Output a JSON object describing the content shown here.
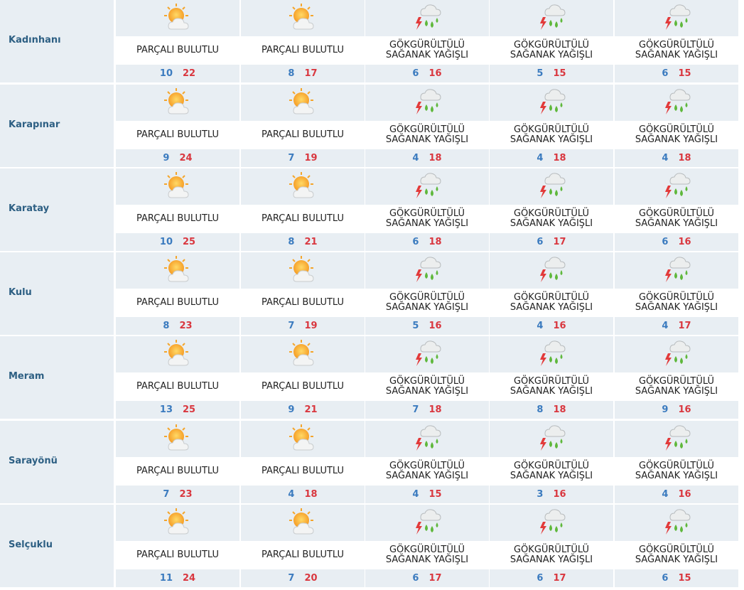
{
  "colors": {
    "panel": "#e8eef3",
    "district": "#2d5f83",
    "min_temp": "#3b7bbf",
    "max_temp": "#d9373f"
  },
  "rows": [
    {
      "district": "Kadınhanı",
      "days": [
        {
          "icon": "partly-cloudy-icon",
          "condition": "PARÇALI BULUTLU",
          "min": "10",
          "max": "22"
        },
        {
          "icon": "partly-cloudy-icon",
          "condition": "PARÇALI BULUTLU",
          "min": "8",
          "max": "17"
        },
        {
          "icon": "thunderstorm-rain-icon",
          "condition": "GÖKGÜRÜLTÜLÜ\nSAĞANAK YAĞIŞLI",
          "min": "6",
          "max": "16"
        },
        {
          "icon": "thunderstorm-rain-icon",
          "condition": "GÖKGÜRÜLTÜLÜ\nSAĞANAK YAĞIŞLI",
          "min": "5",
          "max": "15"
        },
        {
          "icon": "thunderstorm-rain-icon",
          "condition": "GÖKGÜRÜLTÜLÜ\nSAĞANAK YAĞIŞLI",
          "min": "6",
          "max": "15"
        }
      ]
    },
    {
      "district": "Karapınar",
      "days": [
        {
          "icon": "partly-cloudy-icon",
          "condition": "PARÇALI BULUTLU",
          "min": "9",
          "max": "24"
        },
        {
          "icon": "partly-cloudy-icon",
          "condition": "PARÇALI BULUTLU",
          "min": "7",
          "max": "19"
        },
        {
          "icon": "thunderstorm-rain-icon",
          "condition": "GÖKGÜRÜLTÜLÜ\nSAĞANAK YAĞIŞLI",
          "min": "4",
          "max": "18"
        },
        {
          "icon": "thunderstorm-rain-icon",
          "condition": "GÖKGÜRÜLTÜLÜ\nSAĞANAK YAĞIŞLI",
          "min": "4",
          "max": "18"
        },
        {
          "icon": "thunderstorm-rain-icon",
          "condition": "GÖKGÜRÜLTÜLÜ\nSAĞANAK YAĞIŞLI",
          "min": "4",
          "max": "18"
        }
      ]
    },
    {
      "district": "Karatay",
      "days": [
        {
          "icon": "partly-cloudy-icon",
          "condition": "PARÇALI BULUTLU",
          "min": "10",
          "max": "25"
        },
        {
          "icon": "partly-cloudy-icon",
          "condition": "PARÇALI BULUTLU",
          "min": "8",
          "max": "21"
        },
        {
          "icon": "thunderstorm-rain-icon",
          "condition": "GÖKGÜRÜLTÜLÜ\nSAĞANAK YAĞIŞLI",
          "min": "6",
          "max": "18"
        },
        {
          "icon": "thunderstorm-rain-icon",
          "condition": "GÖKGÜRÜLTÜLÜ\nSAĞANAK YAĞIŞLI",
          "min": "6",
          "max": "17"
        },
        {
          "icon": "thunderstorm-rain-icon",
          "condition": "GÖKGÜRÜLTÜLÜ\nSAĞANAK YAĞIŞLI",
          "min": "6",
          "max": "16"
        }
      ]
    },
    {
      "district": "Kulu",
      "days": [
        {
          "icon": "partly-cloudy-icon",
          "condition": "PARÇALI BULUTLU",
          "min": "8",
          "max": "23"
        },
        {
          "icon": "partly-cloudy-icon",
          "condition": "PARÇALI BULUTLU",
          "min": "7",
          "max": "19"
        },
        {
          "icon": "thunderstorm-rain-icon",
          "condition": "GÖKGÜRÜLTÜLÜ\nSAĞANAK YAĞIŞLI",
          "min": "5",
          "max": "16"
        },
        {
          "icon": "thunderstorm-rain-icon",
          "condition": "GÖKGÜRÜLTÜLÜ\nSAĞANAK YAĞIŞLI",
          "min": "4",
          "max": "16"
        },
        {
          "icon": "thunderstorm-rain-icon",
          "condition": "GÖKGÜRÜLTÜLÜ\nSAĞANAK YAĞIŞLI",
          "min": "4",
          "max": "17"
        }
      ]
    },
    {
      "district": "Meram",
      "days": [
        {
          "icon": "partly-cloudy-icon",
          "condition": "PARÇALI BULUTLU",
          "min": "13",
          "max": "25"
        },
        {
          "icon": "partly-cloudy-icon",
          "condition": "PARÇALI BULUTLU",
          "min": "9",
          "max": "21"
        },
        {
          "icon": "thunderstorm-rain-icon",
          "condition": "GÖKGÜRÜLTÜLÜ\nSAĞANAK YAĞIŞLI",
          "min": "7",
          "max": "18"
        },
        {
          "icon": "thunderstorm-rain-icon",
          "condition": "GÖKGÜRÜLTÜLÜ\nSAĞANAK YAĞIŞLI",
          "min": "8",
          "max": "18"
        },
        {
          "icon": "thunderstorm-rain-icon",
          "condition": "GÖKGÜRÜLTÜLÜ\nSAĞANAK YAĞIŞLI",
          "min": "9",
          "max": "16"
        }
      ]
    },
    {
      "district": "Sarayönü",
      "days": [
        {
          "icon": "partly-cloudy-icon",
          "condition": "PARÇALI BULUTLU",
          "min": "7",
          "max": "23"
        },
        {
          "icon": "partly-cloudy-icon",
          "condition": "PARÇALI BULUTLU",
          "min": "4",
          "max": "18"
        },
        {
          "icon": "thunderstorm-rain-icon",
          "condition": "GÖKGÜRÜLTÜLÜ\nSAĞANAK YAĞIŞLI",
          "min": "4",
          "max": "15"
        },
        {
          "icon": "thunderstorm-rain-icon",
          "condition": "GÖKGÜRÜLTÜLÜ\nSAĞANAK YAĞIŞLI",
          "min": "3",
          "max": "16"
        },
        {
          "icon": "thunderstorm-rain-icon",
          "condition": "GÖKGÜRÜLTÜLÜ\nSAĞANAK YAĞIŞLI",
          "min": "4",
          "max": "16"
        }
      ]
    },
    {
      "district": "Selçuklu",
      "days": [
        {
          "icon": "partly-cloudy-icon",
          "condition": "PARÇALI BULUTLU",
          "min": "11",
          "max": "24"
        },
        {
          "icon": "partly-cloudy-icon",
          "condition": "PARÇALI BULUTLU",
          "min": "7",
          "max": "20"
        },
        {
          "icon": "thunderstorm-rain-icon",
          "condition": "GÖKGÜRÜLTÜLÜ\nSAĞANAK YAĞIŞLI",
          "min": "6",
          "max": "17"
        },
        {
          "icon": "thunderstorm-rain-icon",
          "condition": "GÖKGÜRÜLTÜLÜ\nSAĞANAK YAĞIŞLI",
          "min": "6",
          "max": "17"
        },
        {
          "icon": "thunderstorm-rain-icon",
          "condition": "GÖKGÜRÜLTÜLÜ\nSAĞANAK YAĞIŞLI",
          "min": "6",
          "max": "15"
        }
      ]
    }
  ]
}
